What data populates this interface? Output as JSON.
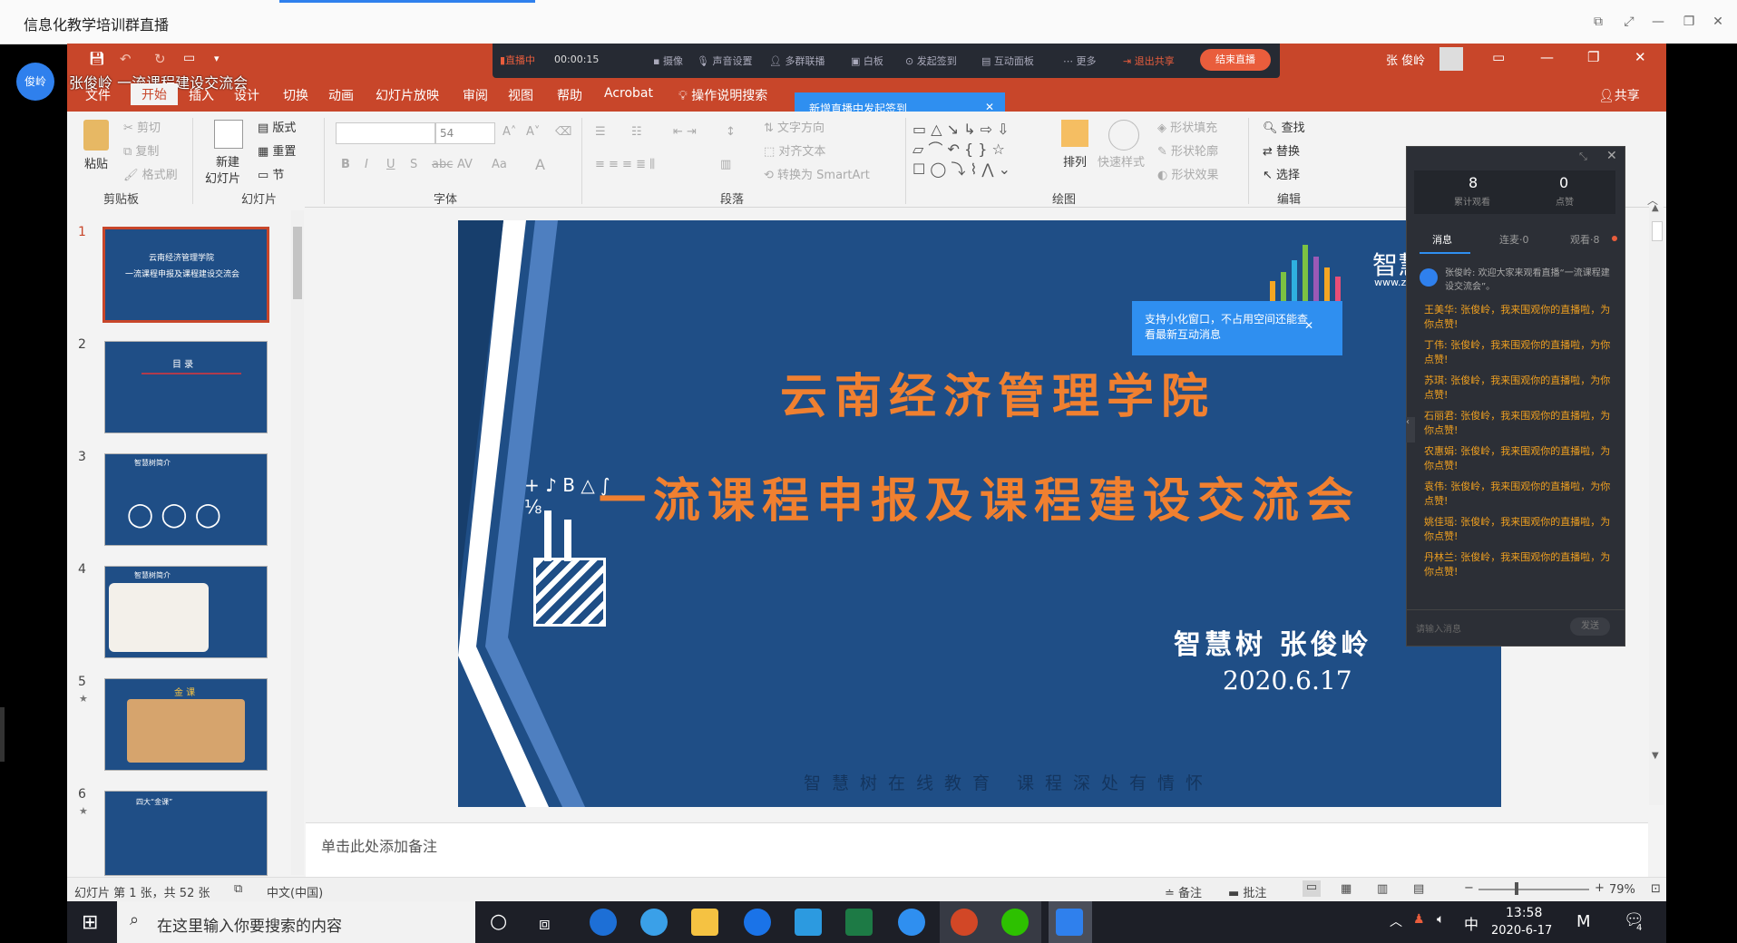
{
  "window": {
    "title": "信息化教学培训群直播"
  },
  "host": {
    "avatar": "俊岭",
    "title": "张俊岭 一流课程建设交流会"
  },
  "live_bar": {
    "status": "直播中",
    "timer": "00:00:15",
    "items": [
      "摄像",
      "声音设置",
      "多群联播",
      "白板",
      "发起签到",
      "互动面板",
      "更多",
      "退出共享"
    ],
    "end_button": "结束直播"
  },
  "ppt": {
    "user": "张 俊岭",
    "share": "共享",
    "menu": [
      "文件",
      "开始",
      "插入",
      "设计",
      "切换",
      "动画",
      "幻灯片放映",
      "审阅",
      "视图",
      "帮助",
      "Acrobat",
      "操作说明搜索"
    ],
    "ribbon": {
      "clipboard": {
        "paste": "粘贴",
        "cut": "剪切",
        "copy": "复制",
        "format_painter": "格式刷",
        "label": "剪贴板"
      },
      "slides": {
        "new_slide": "新建",
        "new_slide2": "幻灯片",
        "layout": "版式",
        "reset": "重置",
        "section": "节",
        "label": "幻灯片"
      },
      "font": {
        "size": "54",
        "label": "字体"
      },
      "paragraph": {
        "text_direction": "文字方向",
        "align_text": "对齐文本",
        "smartart": "转换为 SmartArt",
        "label": "段落"
      },
      "drawing": {
        "arrange": "排列",
        "quick_styles": "快速样式",
        "fill": "形状填充",
        "outline": "形状轮廓",
        "effects": "形状效果",
        "label": "绘图"
      },
      "editing": {
        "find": "查找",
        "replace": "替换",
        "select": "选择",
        "label": "编辑"
      }
    },
    "notes_placeholder": "单击此处添加备注",
    "status": {
      "slide_info": "幻灯片 第 1 张，共 52 张",
      "language": "中文(中国)",
      "notes": "备注",
      "comments": "批注",
      "zoom": "79%"
    }
  },
  "thumbnails": [
    {
      "num": "1",
      "title": "云南经济管理学院",
      "subtitle": "一流课程申报及课程建设交流会"
    },
    {
      "num": "2",
      "title": "目 录"
    },
    {
      "num": "3",
      "title": "智慧树简介"
    },
    {
      "num": "4",
      "title": "智慧树简介"
    },
    {
      "num": "5",
      "title": "金 课"
    },
    {
      "num": "6",
      "title": "四大“金课”"
    }
  ],
  "slide": {
    "title1": "云南经济管理学院",
    "title2": "一流课程申报及课程建设交流会",
    "author": "智慧树   张俊岭",
    "date": "2020.6.17",
    "footer": "智慧树在线教育   课程深处有情怀",
    "logo_text": "智慧",
    "logo_url": "www.z"
  },
  "tips": {
    "signin": "新增直播中发起签到",
    "small_window": "支持小化窗口，不占用空间还能查看最新互动消息"
  },
  "chat": {
    "viewers_count": "8",
    "viewers_label": "累计观看",
    "likes_count": "0",
    "likes_label": "点赞",
    "tabs": [
      "消息",
      "连麦·0",
      "观看·8"
    ],
    "welcome": "张俊岭: 欢迎大家来观看直播“一流课程建设交流会”。",
    "messages": [
      "王美华: 张俊岭，我来围观你的直播啦，为你点赞!",
      "丁伟: 张俊岭，我来围观你的直播啦，为你点赞!",
      "苏琪: 张俊岭，我来围观你的直播啦，为你点赞!",
      "石丽君: 张俊岭，我来围观你的直播啦，为你点赞!",
      "农惠娟: 张俊岭，我来围观你的直播啦，为你点赞!",
      "袁伟: 张俊岭，我来围观你的直播啦，为你点赞!",
      "姚佳瑶: 张俊岭，我来围观你的直播啦，为你点赞!",
      "丹林兰: 张俊岭，我来围观你的直播啦，为你点赞!"
    ],
    "input_placeholder": "请输入消息",
    "send": "发送"
  },
  "taskbar": {
    "search_placeholder": "在这里输入你要搜索的内容",
    "time": "13:58",
    "date": "2020-6-17",
    "ime": "中",
    "notif_count": "4"
  }
}
